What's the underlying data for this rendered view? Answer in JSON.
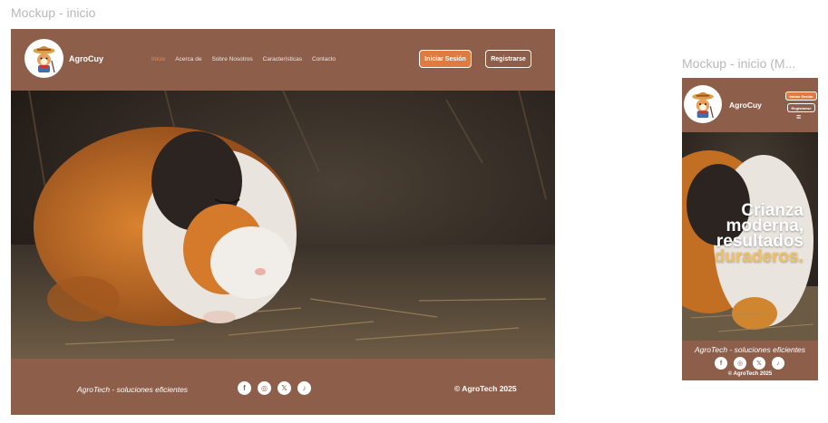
{
  "frames": {
    "desktop_label": "Mockup - inicio",
    "mobile_label": "Mockup -  inicio (M..."
  },
  "brand": {
    "name": "AgroCuy",
    "logo_icon": "guinea-pig-farmer-logo-icon"
  },
  "nav": {
    "items": [
      {
        "label": "Inicio",
        "active": true
      },
      {
        "label": "Acerca de",
        "active": false
      },
      {
        "label": "Sobre Nosotros",
        "active": false
      },
      {
        "label": "Características",
        "active": false
      },
      {
        "label": "Contacto",
        "active": false
      }
    ]
  },
  "auth": {
    "login_label": "Iniciar Sesión",
    "register_label": "Registrarse"
  },
  "mobile": {
    "menu_icon": "≡",
    "headline_lines": [
      "Crianza",
      "moderna,",
      "resultados"
    ],
    "headline_accent": "duraderos."
  },
  "footer": {
    "tagline": "AgroTech - soluciones eficientes",
    "socials": [
      {
        "name": "facebook-icon",
        "glyph": "f"
      },
      {
        "name": "instagram-icon",
        "glyph": "◎"
      },
      {
        "name": "x-icon",
        "glyph": "𝕏"
      },
      {
        "name": "tiktok-icon",
        "glyph": "♪"
      }
    ],
    "copyright": "© AgroTech 2025"
  },
  "colors": {
    "header_brown": "#8d5f4b",
    "accent_orange": "#e07b3f",
    "active_nav": "#f08a4b",
    "headline_accent": "#f2c063"
  }
}
